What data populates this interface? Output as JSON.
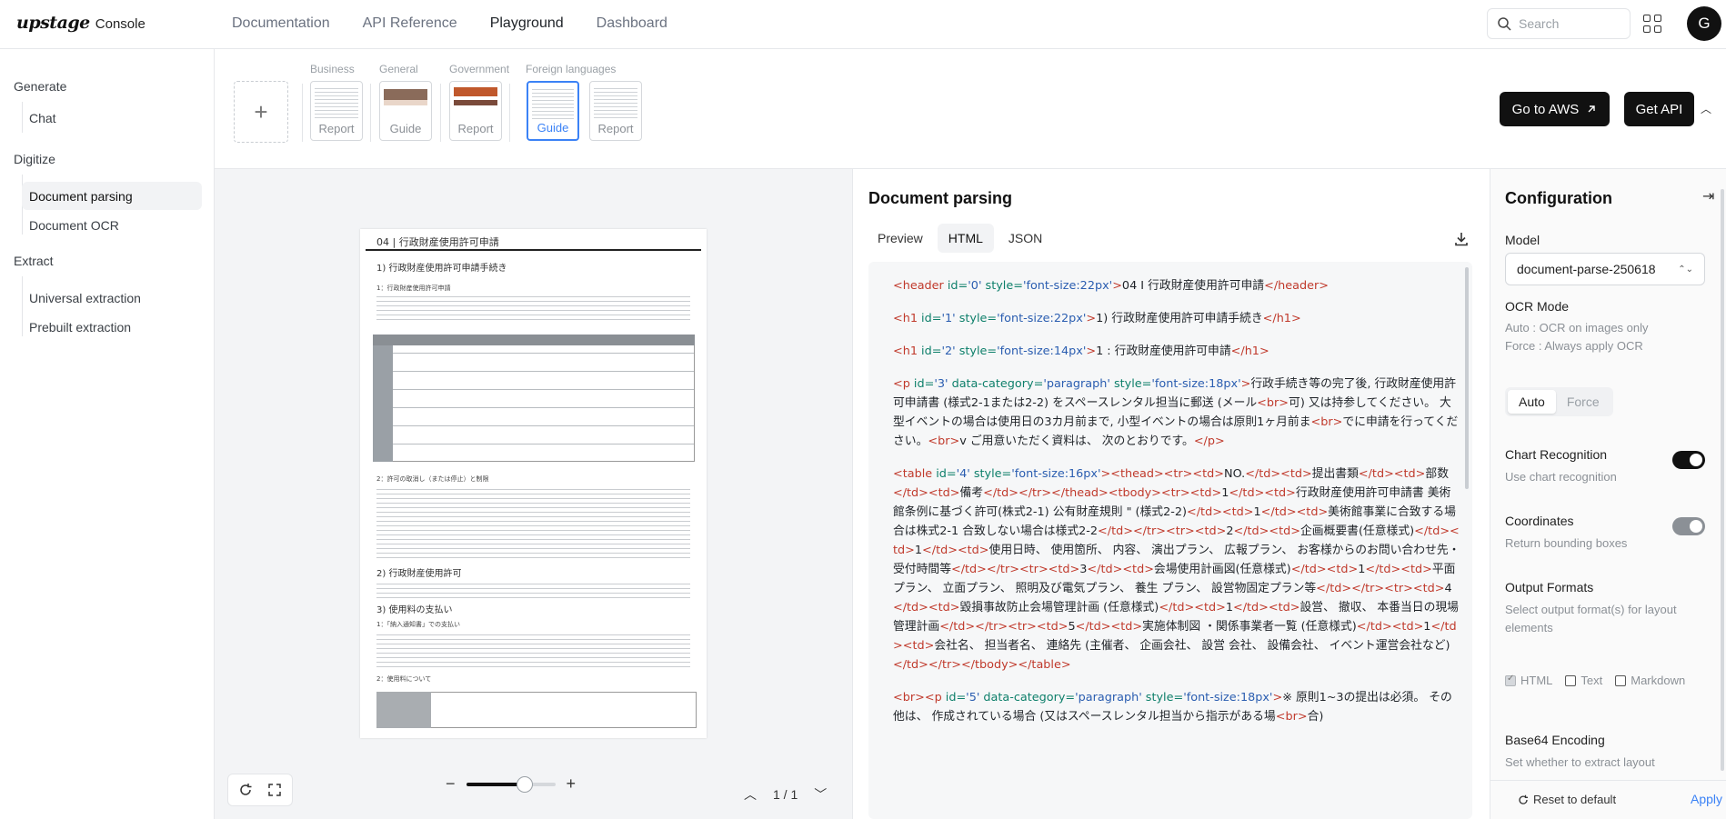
{
  "brand": {
    "logo": "upstage",
    "suffix": "Console"
  },
  "nav": [
    "Documentation",
    "API Reference",
    "Playground",
    "Dashboard"
  ],
  "search": {
    "placeholder": "Search"
  },
  "user": {
    "initial": "G"
  },
  "sidebar": {
    "groups": [
      {
        "label": "Generate",
        "items": [
          "Chat"
        ]
      },
      {
        "label": "Digitize",
        "items": [
          "Document parsing",
          "Document OCR"
        ]
      },
      {
        "label": "Extract",
        "items": [
          "Universal extraction",
          "Prebuilt extraction"
        ]
      }
    ],
    "active": "Document parsing"
  },
  "samples": {
    "categories": [
      "Business",
      "General",
      "Government",
      "Foreign languages"
    ],
    "thumbs": [
      "Report",
      "Guide",
      "Report",
      "Guide",
      "Report"
    ],
    "selected_index": 3
  },
  "actions": {
    "aws": "Go to AWS",
    "api": "Get API"
  },
  "document": {
    "header": "04 | 行政財産使用許可申請",
    "h1": "1) 行政財産使用許可申請手続き",
    "h1b": "1：行政財産使用許可申請",
    "h2": "2：許可の取消し（または停止）と制限",
    "h3": "2) 行政財産使用許可",
    "h4": "3) 使用料の支払い",
    "h5": "1：「納入通知書」での支払い",
    "h6": "2：使用料について"
  },
  "viewer": {
    "page_indicator": "1 / 1",
    "zoom_percent": 66
  },
  "output": {
    "title": "Document parsing",
    "tabs": [
      "Preview",
      "HTML",
      "JSON"
    ],
    "active_tab": "HTML",
    "lines": [
      {
        "tag": "header",
        "id": "0",
        "style": "font-size:22px",
        "text": "04 I 行政財産使用許可申請"
      },
      {
        "tag": "h1",
        "id": "1",
        "style": "font-size:22px",
        "text": "1) 行政財産使用許可申請手続き"
      },
      {
        "tag": "h1",
        "id": "2",
        "style": "font-size:14px",
        "text": "1 : 行政財産使用許可申請"
      },
      {
        "tag": "p",
        "id": "3",
        "category": "paragraph",
        "style": "font-size:18px",
        "text": "行政手続き等の完了後, 行政財産使用許可申請書 (様式2-1または2-2) をスペースレンタル担当に郵送 (メール<br>可) 又は持参してください。 大型イベントの場合は使用日の3カ月前まで, 小型イベントの場合は原則1ヶ月前ま<br>でに申請を行ってください。<br>v ご用意いただく資料は、 次のとおりです。"
      },
      {
        "tag": "table",
        "id": "4",
        "style": "font-size:16px",
        "text": "<thead><tr><td>NO.</td><td>提出書類</td><td>部数</td><td>備考</td></tr></thead><tbody><tr><td>1</td><td>行政財産使用許可申請書 美術館条例に基づく許可(株式2-1) 公有財産規則 \" (様式2-2)</td><td>1</td><td>美術館事業に合致する場合は株式2-1 合致しない場合は様式2-2</td></tr><tr><td>2</td><td>企画概要書(任意様式)</td><td>1</td><td>使用日時、 使用箇所、 内容、 演出プラン、 広報プラン、 お客様からのお問い合わせ先・受付時間等</td></tr><tr><td>3</td><td>会場使用計画図(任意様式)</td><td>1</td><td>平面プラン、 立面プラン、 照明及び電気プラン、 養生 プラン、 設営物固定プラン等</td></tr><tr><td>4</td><td>毀損事故防止会場管理計画 (任意様式)</td><td>1</td><td>設営、 撤収、 本番当日の現場管理計画</td></tr><tr><td>5</td><td>実施体制図 ・関係事業者一覧 (任意様式)</td><td>1</td><td>会社名、 担当者名、 連絡先 (主催者、 企画会社、 設営 会社、 設備会社、 イベント運営会社など)</td></tr></tbody>"
      },
      {
        "tag": "p",
        "id": "5",
        "category": "paragraph",
        "style": "font-size:18px",
        "prefix": "<br>",
        "text": "※ 原則1~3の提出は必須。 その他は、 作成されている場合 (又はスペースレンタル担当から指示がある場<br>合)"
      }
    ]
  },
  "config": {
    "title": "Configuration",
    "model_label": "Model",
    "model_value": "document-parse-250618",
    "ocr_label": "OCR Mode",
    "ocr_desc1": "Auto : OCR on images only",
    "ocr_desc2": "Force : Always apply OCR",
    "ocr_options": [
      "Auto",
      "Force"
    ],
    "ocr_selected": "Auto",
    "chart_label": "Chart Recognition",
    "chart_desc": "Use chart recognition",
    "chart_on": true,
    "coord_label": "Coordinates",
    "coord_desc": "Return bounding boxes",
    "coord_on": true,
    "output_label": "Output Formats",
    "output_desc": "Select output format(s) for layout elements",
    "formats": [
      {
        "label": "HTML",
        "checked": true
      },
      {
        "label": "Text",
        "checked": false
      },
      {
        "label": "Markdown",
        "checked": false
      }
    ],
    "b64_label": "Base64 Encoding",
    "b64_desc": "Set whether to extract layout",
    "reset": "Reset to default",
    "apply": "Apply"
  },
  "colors": {
    "accent": "#3b82f6",
    "dark": "#111111",
    "tag": "#c0392b",
    "attr": "#0d7f6a",
    "value": "#2a5db0"
  }
}
